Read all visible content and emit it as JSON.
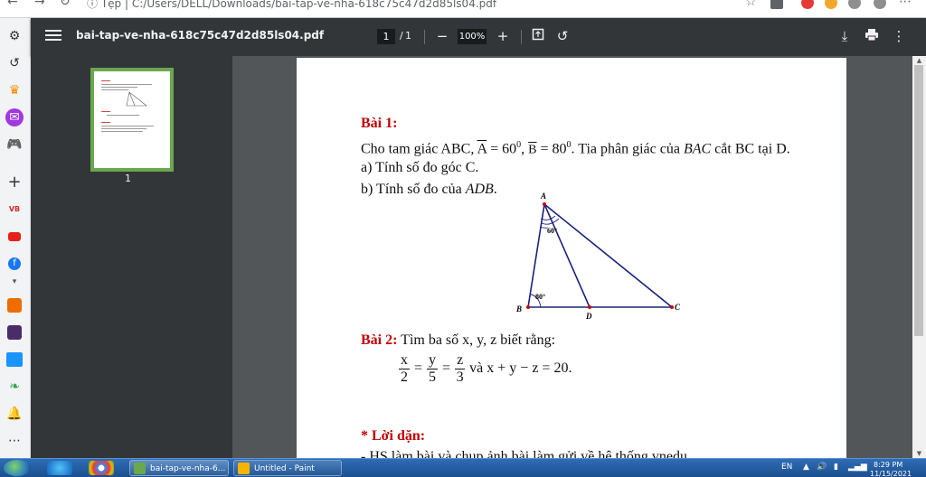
{
  "address_bar": {
    "scheme_label": "Tệp",
    "url": "C:/Users/DELL/Downloads/bai-tap-ve-nha-618c75c47d2d85ls04.pdf"
  },
  "pdf_toolbar": {
    "file_name": "bai-tap-ve-nha-618c75c47d2d85ls04.pdf",
    "current_page": "1",
    "page_separator": "/",
    "total_pages": "1",
    "zoom": "100%"
  },
  "thumbnails": [
    {
      "label": "1"
    }
  ],
  "document": {
    "bai1_title": "Bài 1:",
    "bai1_line1_a": "Cho tam giác ABC, ",
    "bai1_angle_a": "A",
    "bai1_eq_a": " = 60",
    "bai1_sup_a": "0",
    "bai1_comma": ", ",
    "bai1_angle_b": "B",
    "bai1_eq_b": " = 80",
    "bai1_sup_b": "0",
    "bai1_line1_rest_a": ". Tia phân giác của ",
    "bai1_bac": "BAC",
    "bai1_line1_rest_b": " cắt BC tại D.",
    "bai1_qa": "a) Tính số đo góc C.",
    "bai1_qb_text": "b) Tính số đo của ",
    "bai1_qb_angle": "ADB",
    "bai1_qb_end": ".",
    "figure": {
      "label_a": "A",
      "label_b": "B",
      "label_c": "C",
      "label_d": "D",
      "angle_a": "60°",
      "angle_b": "80°"
    },
    "bai2_title": "Bài 2:",
    "bai2_text": " Tìm ba số x, y, z biết rằng:",
    "bai2_frac1_num": "x",
    "bai2_frac1_den": "2",
    "bai2_frac2_num": "y",
    "bai2_frac2_den": "5",
    "bai2_frac3_num": "z",
    "bai2_frac3_den": "3",
    "bai2_eq": "=",
    "bai2_tail": " và  x + y − z = 20.",
    "loidan_title": "* Lời dặn:",
    "loidan_line": "- HS làm bài và chụp ảnh bài làm gửi về hệ thống vnedu"
  },
  "taskbar": {
    "tasks": [
      {
        "label": "bai-tap-ve-nha-6..."
      },
      {
        "label": "Untitled - Paint"
      }
    ],
    "language": "EN",
    "time": "8:29 PM",
    "date": "11/15/2021"
  },
  "colors": {
    "toolbar_bg": "#323639",
    "viewer_bg": "#525659",
    "heading_red": "#c00000",
    "thumbnail_border": "#6aa84f",
    "taskbar_blue": "#1b4f8f"
  }
}
